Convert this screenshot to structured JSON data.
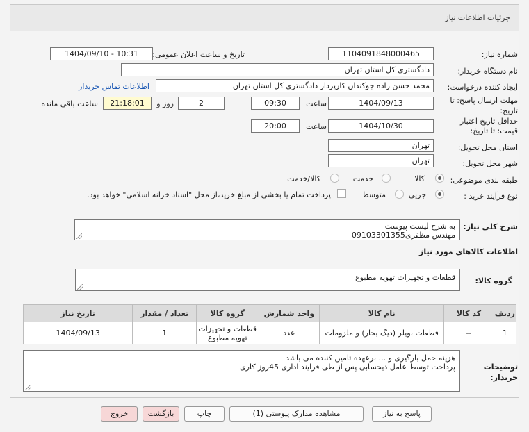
{
  "header": {
    "title": "جزئیات اطلاعات نیاز"
  },
  "fields": {
    "need_number": {
      "label": "شماره نیاز:",
      "value": "1104091848000465"
    },
    "announce_datetime": {
      "label": "تاریخ و ساعت اعلان عمومی:",
      "value": "1404/09/10 - 10:31"
    },
    "buyer_org": {
      "label": "نام دستگاه خریدار:",
      "value": "دادگستری کل استان تهران"
    },
    "requester": {
      "label": "ایجاد کننده درخواست:",
      "value": "محمد حسن زاده جوکندان کارپرداز دادگستری کل استان تهران",
      "contact_link": "اطلاعات تماس خریدار"
    },
    "reply_deadline": {
      "label_line1": "مهلت ارسال پاسخ: تا",
      "label_line2": "تاریخ:",
      "date": "1404/09/13",
      "time_label": "ساعت",
      "time": "09:30",
      "days": "2",
      "days_label": "روز و",
      "remaining": "21:18:01",
      "remaining_label": "ساعت باقی مانده"
    },
    "price_validity": {
      "label_line1": "حداقل تاریخ اعتبار",
      "label_line2": "قیمت: تا تاریخ:",
      "date": "1404/10/30",
      "time_label": "ساعت",
      "time": "20:00"
    },
    "delivery_province": {
      "label": "استان محل تحویل:",
      "value": "تهران"
    },
    "delivery_city": {
      "label": "شهر محل تحویل:",
      "value": "تهران"
    },
    "category": {
      "label": "طبقه بندی موضوعی:",
      "options": [
        {
          "label": "کالا",
          "selected": true
        },
        {
          "label": "خدمت",
          "selected": false
        },
        {
          "label": "کالا/خدمت",
          "selected": false
        }
      ]
    },
    "process_type": {
      "label": "نوع فرآیند خرید :",
      "options": [
        {
          "label": "جزیی",
          "selected": true
        },
        {
          "label": "متوسط",
          "selected": false
        }
      ],
      "checkbox_label": "پرداخت تمام یا بخشی از مبلغ خرید،از محل \"اسناد خزانه اسلامی\" خواهد بود."
    },
    "general_description": {
      "label": "شرح کلی نیاز:",
      "line1": "به شرح لیست پیوست",
      "line2": "مهندس مظفری09103301355"
    }
  },
  "goods_section": {
    "title": "اطلاعات کالاهای مورد نیاز"
  },
  "goods_group": {
    "label": "گروه کالا:",
    "value": "قطعات و تجهیزات تهویه مطبوع"
  },
  "table": {
    "headers": [
      "ردیف",
      "کد کالا",
      "نام کالا",
      "واحد شمارش",
      "گروه کالا",
      "تعداد / مقدار",
      "تاریخ نیاز"
    ],
    "rows": [
      [
        "1",
        "--",
        "قطعات بویلر (دیگ بخار) و ملزومات",
        "عدد",
        "قطعات و تجهیزات تهویه مطبوع",
        "1",
        "1404/09/13"
      ]
    ]
  },
  "buyer_notes": {
    "label_line1": "توضیحات",
    "label_line2": "خریدار:",
    "line1": "هزینه حمل بارگیری و ... برعهده تامین کننده می باشد",
    "line2": "پرداخت توسط عامل ذیحسابی پس از طی فرایند اداری 45روز کاری"
  },
  "buttons": {
    "reply": "پاسخ به نیاز",
    "attachments": "مشاهده مدارک پیوستی (1)",
    "print": "چاپ",
    "back": "بازگشت",
    "exit": "خروج"
  },
  "colors": {
    "highlight_box": "#fffbd0",
    "link": "#1a57b3",
    "pink_button": "#f7d7d7",
    "table_header": "#dcdcdc"
  }
}
